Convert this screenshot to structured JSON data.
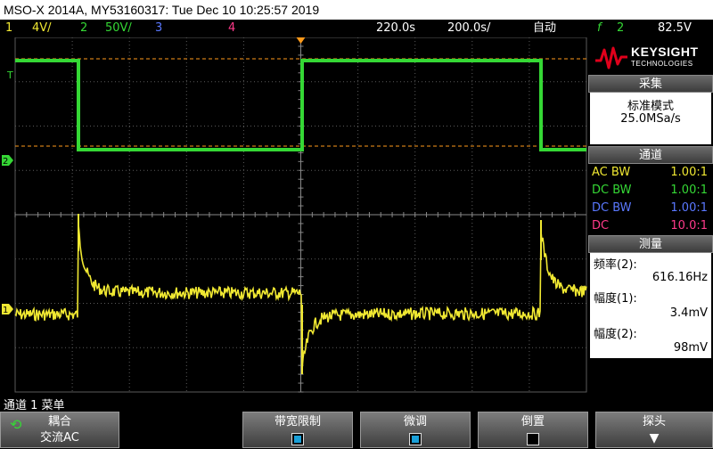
{
  "title": "MSO-X 2014A, MY53160317: Tue Dec 10 10:25:57 2019",
  "status": {
    "ch1_num": "1",
    "ch1_scale": "4V/",
    "ch2_num": "2",
    "ch2_scale": "50V/",
    "ch3_num": "3",
    "ch4_num": "4",
    "time_pos": "220.0s",
    "time_scale": "200.0s/",
    "trig_mode": "自动",
    "trig_icon": "f",
    "trig_src": "2",
    "trig_level": "82.5V"
  },
  "markers": {
    "trigger": "T",
    "ch2": "2",
    "ch1": "1"
  },
  "logo": {
    "brand": "KEYSIGHT",
    "sub": "TECHNOLOGIES"
  },
  "acquire": {
    "header": "采集",
    "mode": "标准模式",
    "rate": "25.0MSa/s"
  },
  "channels": {
    "header": "通道",
    "rows": [
      {
        "coupling": "AC BW",
        "probe": "1.00:1",
        "color": "#f0e832"
      },
      {
        "coupling": "DC BW",
        "probe": "1.00:1",
        "color": "#35d835"
      },
      {
        "coupling": "DC BW",
        "probe": "1.00:1",
        "color": "#5a78ff"
      },
      {
        "coupling": "DC",
        "probe": "10.0:1",
        "color": "#ff3a8a"
      }
    ]
  },
  "measure": {
    "header": "测量",
    "freq_label": "频率(2):",
    "freq_value": "616.16Hz",
    "amp1_label": "幅度(1):",
    "amp1_value": "3.4mV",
    "amp2_label": "幅度(2):",
    "amp2_value": "98mV"
  },
  "menu_label": "通道 1 菜单",
  "softkeys": {
    "coupling_title": "耦合",
    "coupling_value": "交流AC",
    "bw_limit": "带宽限制",
    "fine": "微调",
    "invert": "倒置",
    "probe": "探头"
  },
  "colors": {
    "ch1": "#f0e832",
    "ch2": "#35d835",
    "ch3": "#5a78ff",
    "ch4": "#ff3a8a",
    "trigger": "#ff9a1a",
    "grid": "#5a5a5a"
  }
}
